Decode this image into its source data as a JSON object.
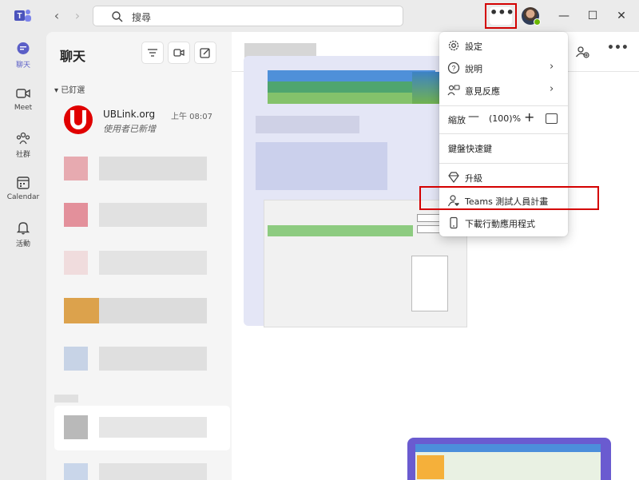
{
  "titlebar": {
    "search_placeholder": "搜尋",
    "more_label": "•••",
    "minimize": "—",
    "maximize": "☐",
    "close": "✕"
  },
  "rail": {
    "items": [
      {
        "label": "聊天",
        "icon": "chat-icon"
      },
      {
        "label": "Meet",
        "icon": "video-icon"
      },
      {
        "label": "社群",
        "icon": "community-icon"
      },
      {
        "label": "Calendar",
        "icon": "calendar-icon"
      },
      {
        "label": "活動",
        "icon": "bell-icon"
      }
    ]
  },
  "chatlist": {
    "title": "聊天",
    "pinned_header": "▾ 已釘選",
    "pinned": [
      {
        "name": "UBLink.org",
        "time": "上午 08:07",
        "preview": "使用者已新增"
      }
    ]
  },
  "menu": {
    "items": [
      {
        "label": "設定",
        "icon": "gear-icon"
      },
      {
        "label": "說明",
        "icon": "help-icon",
        "has_submenu": true
      },
      {
        "label": "意見反應",
        "icon": "feedback-icon",
        "has_submenu": true
      },
      {
        "label": "鍵盤快速鍵",
        "icon": ""
      },
      {
        "label": "升級",
        "icon": "diamond-icon"
      },
      {
        "label": "Teams 測試人員計畫",
        "icon": "user-heart-icon"
      },
      {
        "label": "下載行動應用程式",
        "icon": "phone-icon"
      }
    ],
    "zoom": {
      "label": "縮放",
      "minus": "—",
      "value": "(100)%",
      "plus": "+"
    }
  },
  "colors": {
    "accent": "#5b5fc7",
    "highlight": "#d40000",
    "brand_red": "#e00000"
  }
}
